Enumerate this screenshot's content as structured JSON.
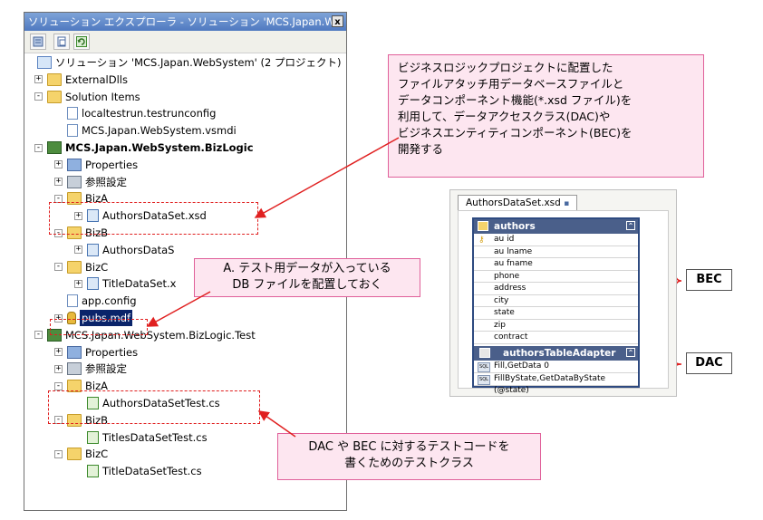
{
  "solution_explorer": {
    "title": "ソリューション エクスプローラ - ソリューション 'MCS.Japan.W...",
    "close_label": "x",
    "tree": [
      {
        "label": "ソリューション 'MCS.Japan.WebSystem' (2 プロジェクト)",
        "icon": "solution-icon",
        "level": 0
      },
      {
        "label": "ExternalDlls",
        "icon": "folder-icon",
        "level": 1,
        "expander": "+"
      },
      {
        "label": "Solution Items",
        "icon": "folder-icon",
        "level": 1,
        "expander": "-"
      },
      {
        "label": "localtestrun.testrunconfig",
        "icon": "file-icon",
        "level": 2
      },
      {
        "label": "MCS.Japan.WebSystem.vsmdi",
        "icon": "file-icon",
        "level": 2
      },
      {
        "label": "MCS.Japan.WebSystem.BizLogic",
        "icon": "project-icon",
        "level": 1,
        "expander": "-",
        "bold": true
      },
      {
        "label": "Properties",
        "icon": "properties-icon",
        "level": 2,
        "expander": "+"
      },
      {
        "label": "参照設定",
        "icon": "references-icon",
        "level": 2,
        "expander": "+"
      },
      {
        "label": "BizA",
        "icon": "folder-icon",
        "level": 2,
        "expander": "-"
      },
      {
        "label": "AuthorsDataSet.xsd",
        "icon": "xsd-icon",
        "level": 3,
        "expander": "+"
      },
      {
        "label": "BizB",
        "icon": "folder-icon",
        "level": 2,
        "expander": "-"
      },
      {
        "label": "AuthorsDataS",
        "icon": "xsd-icon",
        "level": 3,
        "expander": "+"
      },
      {
        "label": "BizC",
        "icon": "folder-icon",
        "level": 2,
        "expander": "-"
      },
      {
        "label": "TitleDataSet.x",
        "icon": "xsd-icon",
        "level": 3,
        "expander": "+"
      },
      {
        "label": "app.config",
        "icon": "file-icon",
        "level": 2
      },
      {
        "label": "pubs.mdf",
        "icon": "database-icon",
        "level": 2,
        "expander": "+",
        "selected": true
      },
      {
        "label": "MCS.Japan.WebSystem.BizLogic.Test",
        "icon": "project-icon",
        "level": 1,
        "expander": "-"
      },
      {
        "label": "Properties",
        "icon": "properties-icon",
        "level": 2,
        "expander": "+"
      },
      {
        "label": "参照設定",
        "icon": "references-icon",
        "level": 2,
        "expander": "+"
      },
      {
        "label": "BizA",
        "icon": "folder-icon",
        "level": 2,
        "expander": "-"
      },
      {
        "label": "AuthorsDataSetTest.cs",
        "icon": "cs-icon",
        "level": 3
      },
      {
        "label": "BizB",
        "icon": "folder-icon",
        "level": 2,
        "expander": "-"
      },
      {
        "label": "TitlesDataSetTest.cs",
        "icon": "cs-icon",
        "level": 3
      },
      {
        "label": "BizC",
        "icon": "folder-icon",
        "level": 2,
        "expander": "-"
      },
      {
        "label": "TitleDataSetTest.cs",
        "icon": "cs-icon",
        "level": 3
      }
    ]
  },
  "callouts": {
    "top": [
      "ビジネスロジックプロジェクトに配置した",
      "ファイルアタッチ用データベースファイルと",
      "データコンポーネント機能(*.xsd ファイル)を",
      "利用して、データアクセスクラス(DAC)や",
      "ビジネスエンティティコンポーネント(BEC)を",
      "開発する"
    ],
    "middle": [
      "A. テスト用データが入っている",
      "DB ファイルを配置しておく"
    ],
    "bottom": [
      "DAC や BEC に対するテストコードを",
      "書くためのテストクラス"
    ]
  },
  "dataset_designer": {
    "tab_label": "AuthorsDataSet.xsd",
    "table_name": "authors",
    "columns": [
      "au id",
      "au lname",
      "au fname",
      "phone",
      "address",
      "city",
      "state",
      "zip",
      "contract"
    ],
    "adapter_name": "authorsTableAdapter",
    "queries": [
      "Fill,GetData 0",
      "FillByState,GetDataByState (@state)"
    ],
    "bec_label": "BEC",
    "dac_label": "DAC"
  }
}
